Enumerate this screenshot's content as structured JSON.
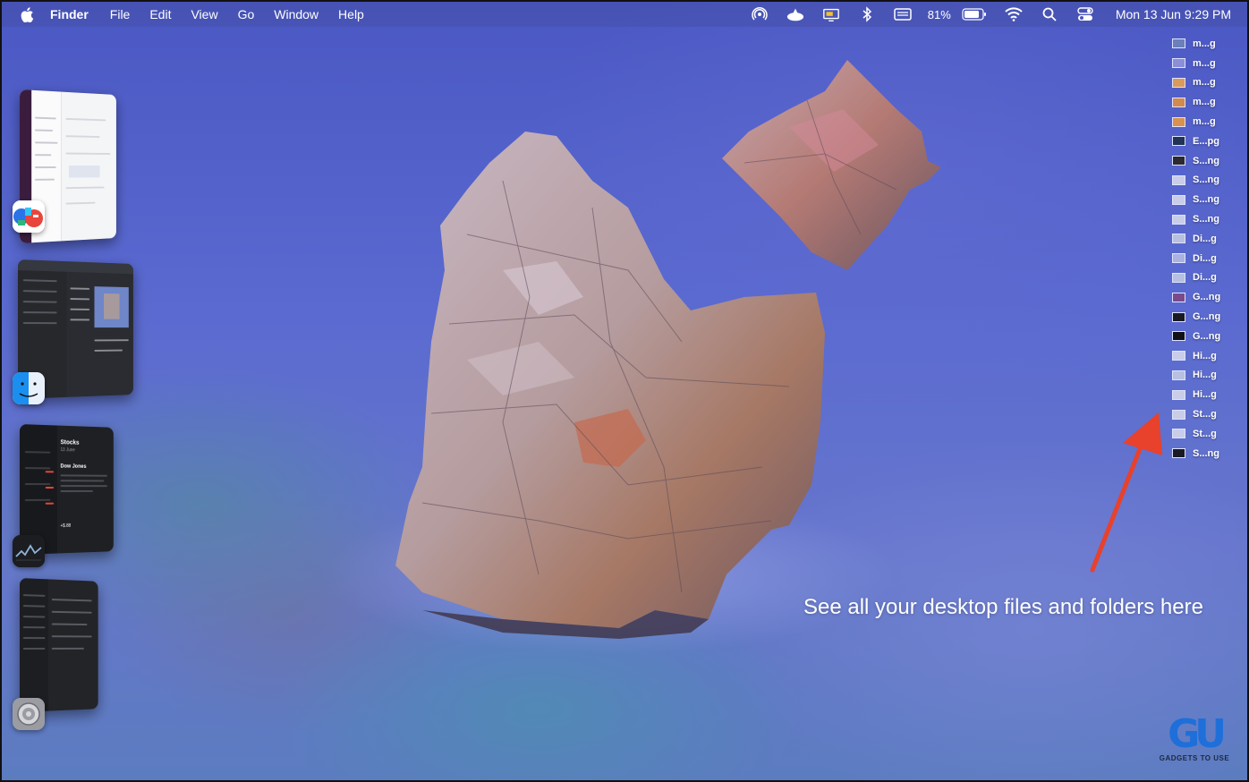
{
  "menubar": {
    "app_name": "Finder",
    "menus": [
      "File",
      "Edit",
      "View",
      "Go",
      "Window",
      "Help"
    ],
    "battery_percent": "81%",
    "clock": "Mon 13 Jun  9:29 PM",
    "status_icons": [
      "airdrop-icon",
      "menubar-extra-icon",
      "display-icon",
      "bluetooth-icon",
      "keyboard-icon",
      "battery-icon",
      "wifi-icon",
      "search-icon",
      "control-center-icon"
    ]
  },
  "stage_manager": {
    "groups": [
      {
        "app": "Slack",
        "icon": "slack-icon"
      },
      {
        "app": "Finder",
        "icon": "finder-icon"
      },
      {
        "app": "Stocks",
        "icon": "stocks-icon",
        "window_title": "Stocks",
        "window_date": "13 June",
        "headline": "Dow Jones",
        "value": "+$.88"
      },
      {
        "app": "System Settings",
        "icon": "settings-icon"
      }
    ]
  },
  "desktop_files": [
    {
      "name": "m...g",
      "thumb": "#6b7fb8"
    },
    {
      "name": "m...g",
      "thumb": "#8a8fd8"
    },
    {
      "name": "m...g",
      "thumb": "#d99a5a"
    },
    {
      "name": "m...g",
      "thumb": "#d4894d"
    },
    {
      "name": "m...g",
      "thumb": "#d9924e"
    },
    {
      "name": "E...pg",
      "thumb": "#223355"
    },
    {
      "name": "S...ng",
      "thumb": "#2a2a30"
    },
    {
      "name": "S...ng",
      "thumb": "#c9cde8"
    },
    {
      "name": "S...ng",
      "thumb": "#c9cde8"
    },
    {
      "name": "S...ng",
      "thumb": "#c9cde8"
    },
    {
      "name": "Di...g",
      "thumb": "#b8c0e0"
    },
    {
      "name": "Di...g",
      "thumb": "#a9b2e0"
    },
    {
      "name": "Di...g",
      "thumb": "#b8c0e0"
    },
    {
      "name": "G...ng",
      "thumb": "#7a4a8a"
    },
    {
      "name": "G...ng",
      "thumb": "#1a1a22"
    },
    {
      "name": "G...ng",
      "thumb": "#111118"
    },
    {
      "name": "Hi...g",
      "thumb": "#c9cde8"
    },
    {
      "name": "Hi...g",
      "thumb": "#b8c0e0"
    },
    {
      "name": "Hi...g",
      "thumb": "#c9cde8"
    },
    {
      "name": "St...g",
      "thumb": "#c9cde8"
    },
    {
      "name": "St...g",
      "thumb": "#c9cde8"
    },
    {
      "name": "S...ng",
      "thumb": "#1a1a22"
    }
  ],
  "annotation": {
    "caption": "See all your desktop files and folders here",
    "arrow_color": "#e8412c"
  },
  "watermark": {
    "logo": "GU",
    "tagline": "GADGETS TO USE"
  }
}
